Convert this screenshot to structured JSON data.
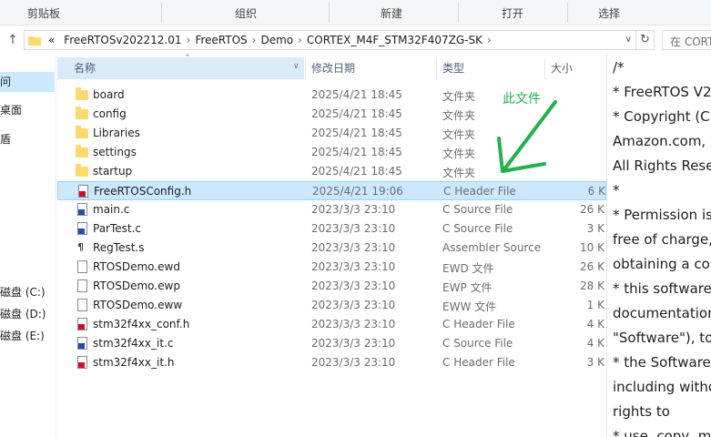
{
  "ribbon": {
    "groups": [
      "剪贴板",
      "组织",
      "新建",
      "打开",
      "选择"
    ]
  },
  "address": {
    "prefix": "«",
    "crumbs": [
      "FreeRTOSv202212.01",
      "FreeRTOS",
      "Demo",
      "CORTEX_M4F_STM32F407ZG-SK"
    ],
    "search_placeholder": "在 CORTEX..."
  },
  "nav": {
    "items": [
      "问",
      "桌面",
      "盾",
      "磁盘 (C:)",
      "磁盘 (D:)",
      "磁盘 (E:)"
    ]
  },
  "columns": {
    "name": "名称",
    "date": "修改日期",
    "type": "类型",
    "size": "大小"
  },
  "files": [
    {
      "name": "board",
      "date": "2025/4/21 18:45",
      "type": "文件夹",
      "size": "",
      "icon": "folder"
    },
    {
      "name": "config",
      "date": "2025/4/21 18:45",
      "type": "文件夹",
      "size": "",
      "icon": "folder"
    },
    {
      "name": "Libraries",
      "date": "2025/4/21 18:45",
      "type": "文件夹",
      "size": "",
      "icon": "folder"
    },
    {
      "name": "settings",
      "date": "2025/4/21 18:45",
      "type": "文件夹",
      "size": "",
      "icon": "folder"
    },
    {
      "name": "startup",
      "date": "2025/4/21 18:45",
      "type": "文件夹",
      "size": "",
      "icon": "folder"
    },
    {
      "name": "FreeRTOSConfig.h",
      "date": "2025/4/21 19:06",
      "type": "C Header File",
      "size": "6 K",
      "icon": "h",
      "selected": true
    },
    {
      "name": "main.c",
      "date": "2023/3/3 23:10",
      "type": "C Source File",
      "size": "26 K",
      "icon": "c"
    },
    {
      "name": "ParTest.c",
      "date": "2023/3/3 23:10",
      "type": "C Source File",
      "size": "3 K",
      "icon": "c"
    },
    {
      "name": "RegTest.s",
      "date": "2023/3/3 23:10",
      "type": "Assembler Source",
      "size": "10 K",
      "icon": "asm"
    },
    {
      "name": "RTOSDemo.ewd",
      "date": "2023/3/3 23:10",
      "type": "EWD 文件",
      "size": "26 K",
      "icon": "doc"
    },
    {
      "name": "RTOSDemo.ewp",
      "date": "2023/3/3 23:10",
      "type": "EWP 文件",
      "size": "28 K",
      "icon": "doc"
    },
    {
      "name": "RTOSDemo.eww",
      "date": "2023/3/3 23:10",
      "type": "EWW 文件",
      "size": "1 K",
      "icon": "doc"
    },
    {
      "name": "stm32f4xx_conf.h",
      "date": "2023/3/3 23:10",
      "type": "C Header File",
      "size": "4 K",
      "icon": "h"
    },
    {
      "name": "stm32f4xx_it.c",
      "date": "2023/3/3 23:10",
      "type": "C Source File",
      "size": "4 K",
      "icon": "c"
    },
    {
      "name": "stm32f4xx_it.h",
      "date": "2023/3/3 23:10",
      "type": "C Header File",
      "size": "3 K",
      "icon": "h"
    }
  ],
  "preview": {
    "lines": [
      "/*",
      " * FreeRTOS V2",
      " * Copyright (C",
      "Amazon.com, I",
      "All Rights Rese",
      " *",
      " * Permission is",
      "free of charge,",
      "obtaining a cop",
      " * this software",
      "documentation",
      "\"Software\"), to",
      " * the Software",
      "including witho",
      "rights to",
      " * use, copy, m"
    ]
  },
  "annotation": {
    "label": "此文件",
    "color": "#22b14c"
  }
}
